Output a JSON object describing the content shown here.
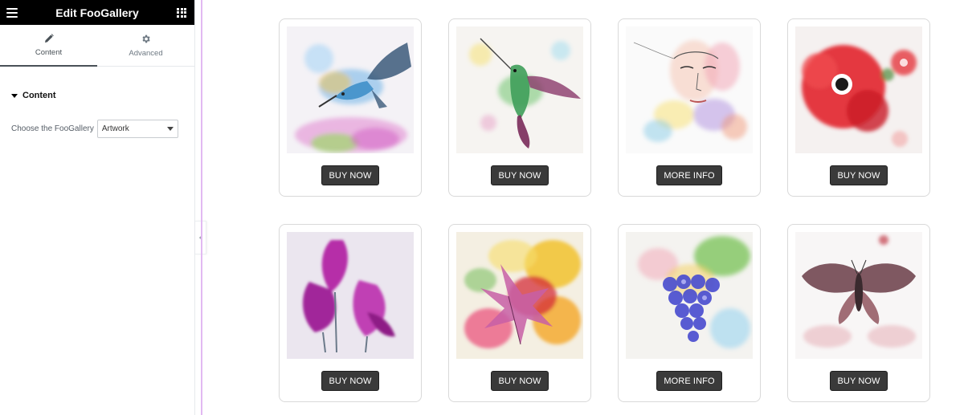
{
  "panel": {
    "title": "Edit FooGallery",
    "tabs": [
      {
        "label": "Content",
        "icon": "pencil-icon",
        "active": true
      },
      {
        "label": "Advanced",
        "icon": "gear-icon",
        "active": false
      }
    ],
    "section_title": "Content",
    "control_label": "Choose the FooGallery",
    "gallery_select_value": "Artwork"
  },
  "colors": {
    "header_bg": "#000000",
    "button_bg": "#3a3a3a",
    "card_border": "#d9d9d9",
    "guide_line": "#e2b9f2"
  },
  "gallery": {
    "items": [
      {
        "subject": "hummingbird-watercolor",
        "button": "BUY NOW"
      },
      {
        "subject": "hummingbird-watercolor-2",
        "button": "BUY NOW"
      },
      {
        "subject": "woman-face-watercolor",
        "button": "MORE INFO"
      },
      {
        "subject": "red-poppy-watercolor",
        "button": "BUY NOW"
      },
      {
        "subject": "purple-tulips-watercolor",
        "button": "BUY NOW"
      },
      {
        "subject": "autumn-leaves-watercolor",
        "button": "BUY NOW"
      },
      {
        "subject": "grapes-watercolor",
        "button": "MORE INFO"
      },
      {
        "subject": "moth-watercolor",
        "button": "BUY NOW"
      }
    ]
  }
}
